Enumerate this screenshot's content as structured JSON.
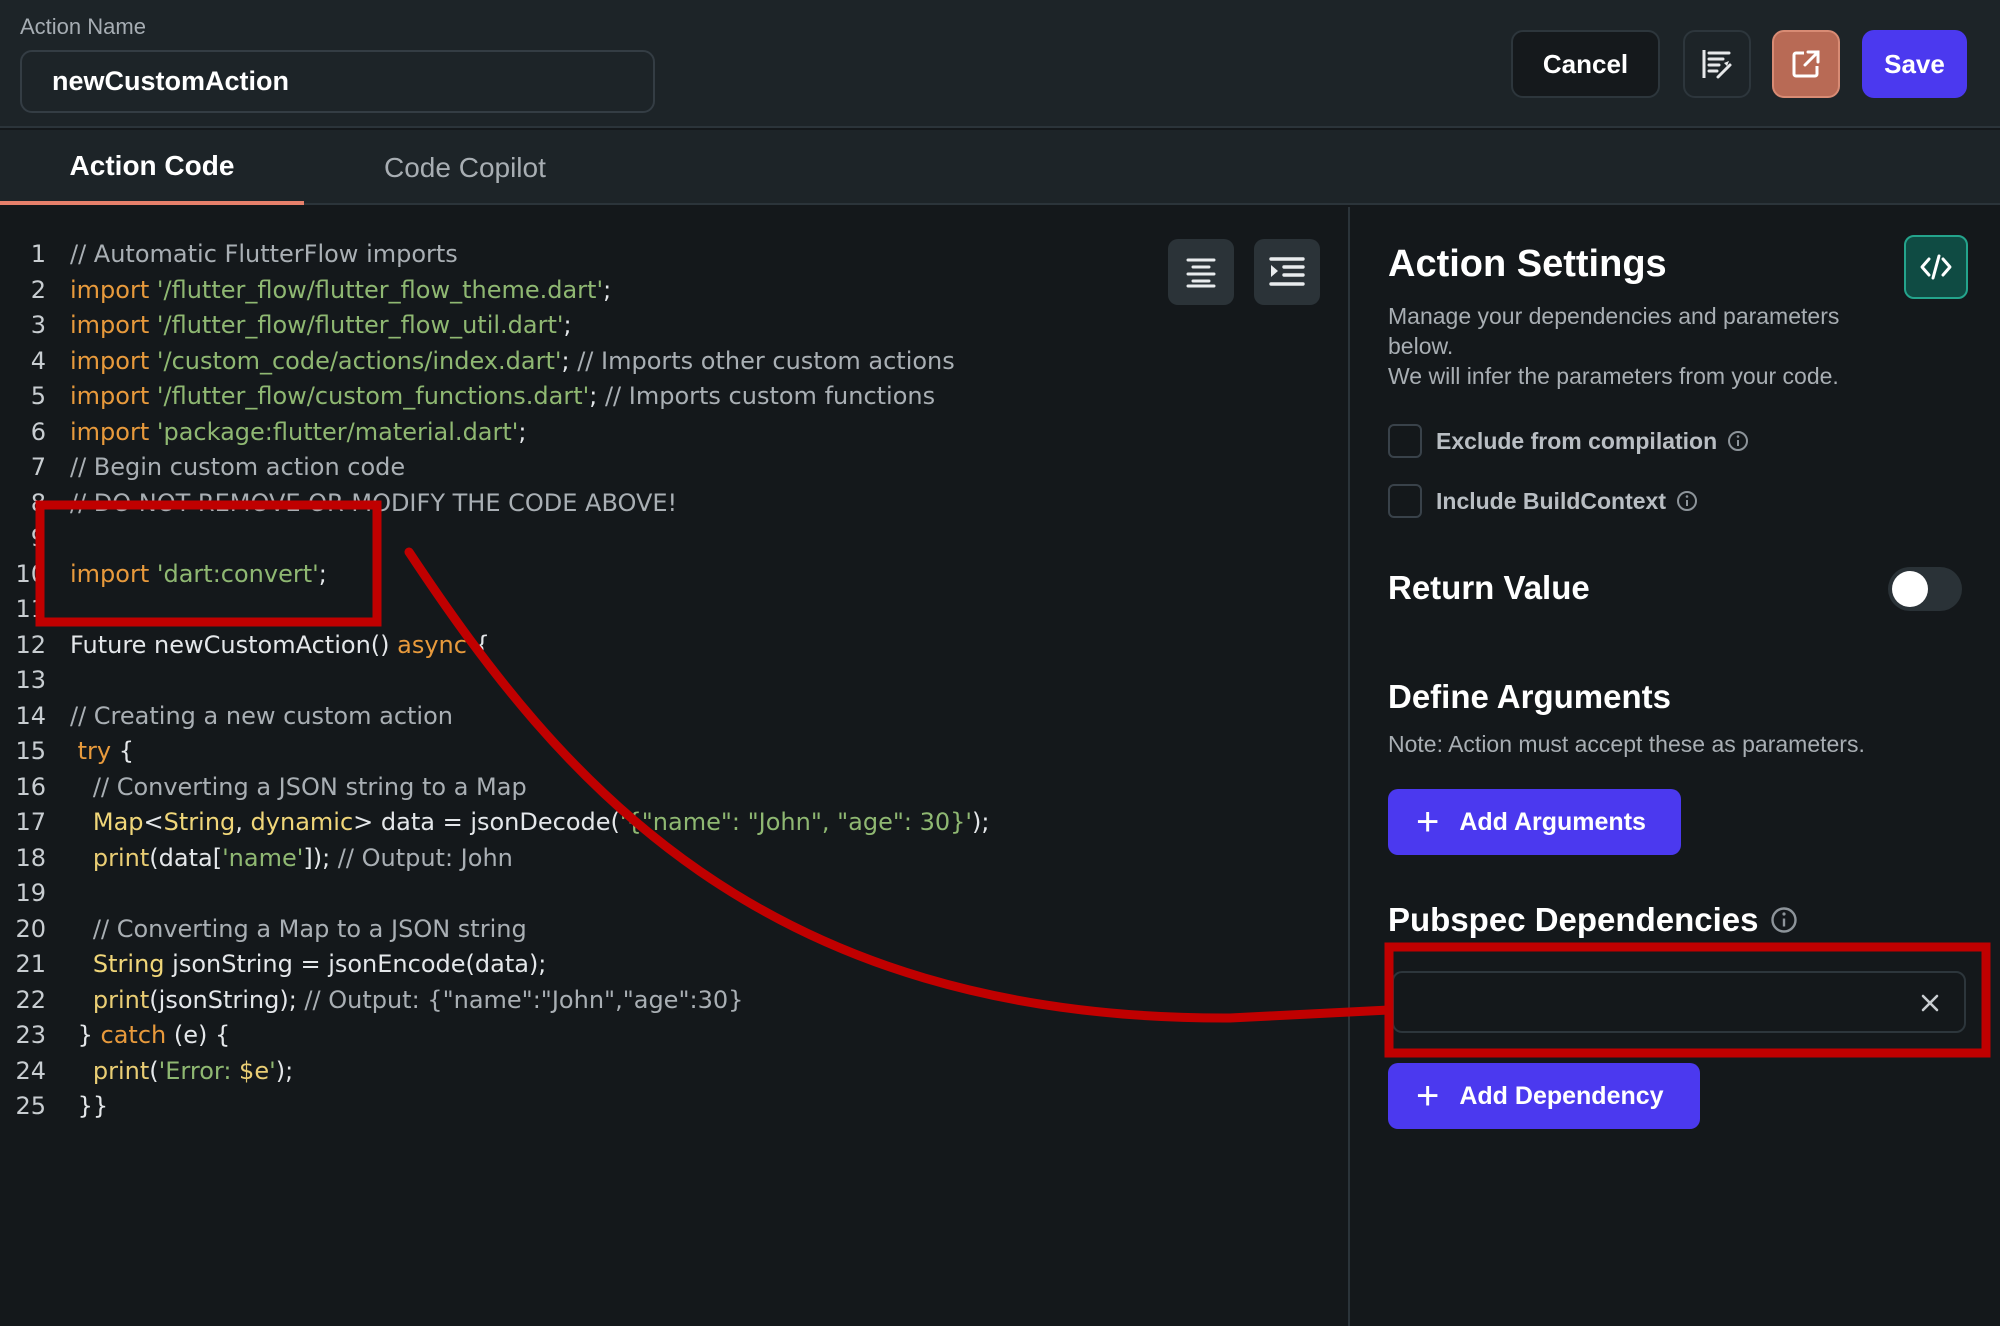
{
  "header": {
    "action_name_label": "Action Name",
    "action_name_value": "newCustomAction",
    "cancel_label": "Cancel",
    "save_label": "Save",
    "format_icon": "format-code-icon",
    "open_icon": "open-external-icon"
  },
  "tabs": [
    {
      "label": "Action Code",
      "active": true
    },
    {
      "label": "Code Copilot",
      "active": false
    }
  ],
  "editor": {
    "tools": [
      "align-center-icon",
      "indent-icon"
    ],
    "lines": [
      {
        "n": "1",
        "tokens": [
          {
            "t": "// Automatic FlutterFlow imports",
            "c": "cm"
          }
        ]
      },
      {
        "n": "2",
        "tokens": [
          {
            "t": "import",
            "c": "kw"
          },
          {
            "t": " ",
            "c": "plain"
          },
          {
            "t": "'/flutter_flow/flutter_flow_theme.dart'",
            "c": "str"
          },
          {
            "t": ";",
            "c": "plain"
          }
        ]
      },
      {
        "n": "3",
        "tokens": [
          {
            "t": "import",
            "c": "kw"
          },
          {
            "t": " ",
            "c": "plain"
          },
          {
            "t": "'/flutter_flow/flutter_flow_util.dart'",
            "c": "str"
          },
          {
            "t": ";",
            "c": "plain"
          }
        ]
      },
      {
        "n": "4",
        "tokens": [
          {
            "t": "import",
            "c": "kw"
          },
          {
            "t": " ",
            "c": "plain"
          },
          {
            "t": "'/custom_code/actions/index.dart'",
            "c": "str"
          },
          {
            "t": "; ",
            "c": "plain"
          },
          {
            "t": "// Imports other custom actions",
            "c": "cm"
          }
        ]
      },
      {
        "n": "5",
        "tokens": [
          {
            "t": "import",
            "c": "kw"
          },
          {
            "t": " ",
            "c": "plain"
          },
          {
            "t": "'/flutter_flow/custom_functions.dart'",
            "c": "str"
          },
          {
            "t": "; ",
            "c": "plain"
          },
          {
            "t": "// Imports custom functions",
            "c": "cm"
          }
        ]
      },
      {
        "n": "6",
        "tokens": [
          {
            "t": "import",
            "c": "kw"
          },
          {
            "t": " ",
            "c": "plain"
          },
          {
            "t": "'package:flutter/material.dart'",
            "c": "str"
          },
          {
            "t": ";",
            "c": "plain"
          }
        ]
      },
      {
        "n": "7",
        "tokens": [
          {
            "t": "// Begin custom action code",
            "c": "cm"
          }
        ]
      },
      {
        "n": "8",
        "tokens": [
          {
            "t": "// DO NOT REMOVE OR MODIFY THE CODE ABOVE!",
            "c": "cm"
          }
        ]
      },
      {
        "n": "9",
        "tokens": []
      },
      {
        "n": "10",
        "tokens": [
          {
            "t": "import",
            "c": "kw"
          },
          {
            "t": " ",
            "c": "plain"
          },
          {
            "t": "'dart:convert'",
            "c": "str"
          },
          {
            "t": ";",
            "c": "plain"
          }
        ]
      },
      {
        "n": "11",
        "tokens": []
      },
      {
        "n": "12",
        "tokens": [
          {
            "t": "Future newCustomAction() ",
            "c": "plain"
          },
          {
            "t": "async",
            "c": "kw"
          },
          {
            "t": " {",
            "c": "plain"
          }
        ]
      },
      {
        "n": "13",
        "tokens": []
      },
      {
        "n": "14",
        "tokens": [
          {
            "t": "// Creating a new custom action",
            "c": "cm"
          }
        ]
      },
      {
        "n": "15",
        "tokens": [
          {
            "t": " ",
            "c": "plain"
          },
          {
            "t": "try",
            "c": "kw"
          },
          {
            "t": " {",
            "c": "plain"
          }
        ]
      },
      {
        "n": "16",
        "tokens": [
          {
            "t": "   // Converting a JSON string to a Map",
            "c": "cm"
          }
        ]
      },
      {
        "n": "17",
        "tokens": [
          {
            "t": "   ",
            "c": "plain"
          },
          {
            "t": "Map",
            "c": "ty"
          },
          {
            "t": "<",
            "c": "plain"
          },
          {
            "t": "String",
            "c": "ty"
          },
          {
            "t": ", ",
            "c": "plain"
          },
          {
            "t": "dynamic",
            "c": "ty"
          },
          {
            "t": "> data = jsonDecode(",
            "c": "plain"
          },
          {
            "t": "'{\"name\": \"John\", \"age\": 30}'",
            "c": "str"
          },
          {
            "t": ");",
            "c": "plain"
          }
        ]
      },
      {
        "n": "18",
        "tokens": [
          {
            "t": "   ",
            "c": "plain"
          },
          {
            "t": "print",
            "c": "fn"
          },
          {
            "t": "(data[",
            "c": "plain"
          },
          {
            "t": "'name'",
            "c": "str"
          },
          {
            "t": "]); ",
            "c": "plain"
          },
          {
            "t": "// Output: John",
            "c": "cm"
          }
        ]
      },
      {
        "n": "19",
        "tokens": []
      },
      {
        "n": "20",
        "tokens": [
          {
            "t": "   // Converting a Map to a JSON string",
            "c": "cm"
          }
        ]
      },
      {
        "n": "21",
        "tokens": [
          {
            "t": "   ",
            "c": "plain"
          },
          {
            "t": "String",
            "c": "ty"
          },
          {
            "t": " jsonString = jsonEncode(data);",
            "c": "plain"
          }
        ]
      },
      {
        "n": "22",
        "tokens": [
          {
            "t": "   ",
            "c": "plain"
          },
          {
            "t": "print",
            "c": "fn"
          },
          {
            "t": "(jsonString); ",
            "c": "plain"
          },
          {
            "t": "// Output: {\"name\":\"John\",\"age\":30}",
            "c": "cm"
          }
        ]
      },
      {
        "n": "23",
        "tokens": [
          {
            "t": " } ",
            "c": "plain"
          },
          {
            "t": "catch",
            "c": "kw"
          },
          {
            "t": " (e) {",
            "c": "plain"
          }
        ]
      },
      {
        "n": "24",
        "tokens": [
          {
            "t": "   ",
            "c": "plain"
          },
          {
            "t": "print",
            "c": "fn"
          },
          {
            "t": "(",
            "c": "plain"
          },
          {
            "t": "'Error: ",
            "c": "str"
          },
          {
            "t": "$e",
            "c": "fn"
          },
          {
            "t": "'",
            "c": "str"
          },
          {
            "t": ");",
            "c": "plain"
          }
        ]
      },
      {
        "n": "25",
        "tokens": [
          {
            "t": " }}",
            "c": "plain"
          }
        ]
      }
    ]
  },
  "settings": {
    "title": "Action Settings",
    "description_1": "Manage your dependencies and parameters below.",
    "description_2": "We will infer the parameters from your code.",
    "code_icon": "code-icon",
    "exclude_label": "Exclude from compilation",
    "include_context_label": "Include BuildContext",
    "exclude_checked": false,
    "include_context_checked": false,
    "return_value_title": "Return Value",
    "return_value_enabled": false,
    "define_arguments_title": "Define Arguments",
    "define_arguments_note": "Note: Action must accept these as parameters.",
    "add_arguments_label": "Add Arguments",
    "pubspec_title": "Pubspec Dependencies",
    "dependency_value": "",
    "add_dependency_label": "Add Dependency"
  },
  "colors": {
    "accent": "#4b39ef",
    "tab_underline": "#e7806b",
    "annotation_red": "#c00000"
  }
}
